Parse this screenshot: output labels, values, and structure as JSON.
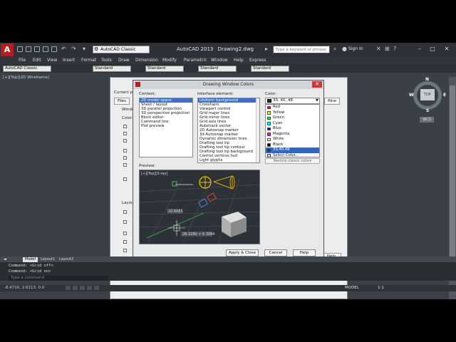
{
  "app": {
    "title": "AutoCAD 2013",
    "drawing": "Drawing2.dwg",
    "workspace": "AutoCAD Classic",
    "search_placeholder": "Type a keyword or phrase",
    "signin": "Sign In"
  },
  "menubar": [
    "File",
    "Edit",
    "View",
    "Insert",
    "Format",
    "Tools",
    "Draw",
    "Dimension",
    "Modify",
    "Parametric",
    "Window",
    "Help",
    "Express"
  ],
  "toolbar2": {
    "workspace": "AutoCAD Classic",
    "styles": [
      "Standard",
      "Standard",
      "Standard",
      "Standard"
    ]
  },
  "viewport_label": "[+][Top][2D Wireframe]",
  "viewcube": {
    "top": "TOP",
    "n": "N",
    "s": "S",
    "w": "W",
    "e": "E",
    "wcs": "WCS"
  },
  "options_dialog": {
    "current_profile": "Current pro",
    "tab_files": "Files",
    "tab_right": "fline",
    "window_label": "Windo",
    "colors_label": "Color",
    "layout_label": "Layout",
    "help": "Help"
  },
  "dwc": {
    "title": "Drawing Window Colors",
    "context_label": "Context:",
    "context_items": [
      "2D model space",
      "Sheet / layout",
      "3D parallel projection",
      "3D perspective projection",
      "Block editor",
      "Command line",
      "Plot preview"
    ],
    "context_selected": 0,
    "element_label": "Interface element:",
    "element_items": [
      "Uniform background",
      "Crosshairs",
      "Viewport control",
      "Grid major lines",
      "Grid minor lines",
      "Grid axis lines",
      "Autotrack vector",
      "2D Autosnap marker",
      "3d Autosnap marker",
      "Dynamic dimension lines",
      "Drafting tool tip",
      "Drafting tool tip contour",
      "Drafting tool tip background",
      "Control vertices hull",
      "Light glyphs"
    ],
    "element_selected": 0,
    "color_label": "Color:",
    "color_current": "33, 40, 48",
    "color_options": [
      {
        "name": "Red",
        "hex": "#ff0000"
      },
      {
        "name": "Yellow",
        "hex": "#ffff00"
      },
      {
        "name": "Green",
        "hex": "#00ff00"
      },
      {
        "name": "Cyan",
        "hex": "#00ffff"
      },
      {
        "name": "Blue",
        "hex": "#0000ff"
      },
      {
        "name": "Magenta",
        "hex": "#ff00ff"
      },
      {
        "name": "White",
        "hex": "#ffffff"
      },
      {
        "name": "Black",
        "hex": "#000000"
      },
      {
        "name": "33,40,48",
        "hex": "#212830"
      },
      {
        "name": "Select Color...",
        "hex": "#d0d0d0"
      }
    ],
    "color_selected": 8,
    "restore_btn": "Restore classic colors",
    "preview_label": "Preview:",
    "preview_viewport": "[+][Top][X-ray]",
    "preview_dim": "10.6063",
    "preview_coords": "28.2280 < 6.3084",
    "apply_close": "Apply & Close",
    "cancel": "Cancel",
    "help": "Help"
  },
  "tabs": [
    "Model",
    "Layout1",
    "Layout2"
  ],
  "command_lines": [
    "Command:  <Grid off>",
    "Command:  <Grid on>"
  ],
  "command_prompt": "Type a command",
  "status": {
    "coords": "-8.4710, 2.6113, 0.0",
    "model": "MODEL",
    "scale": "1:1"
  }
}
